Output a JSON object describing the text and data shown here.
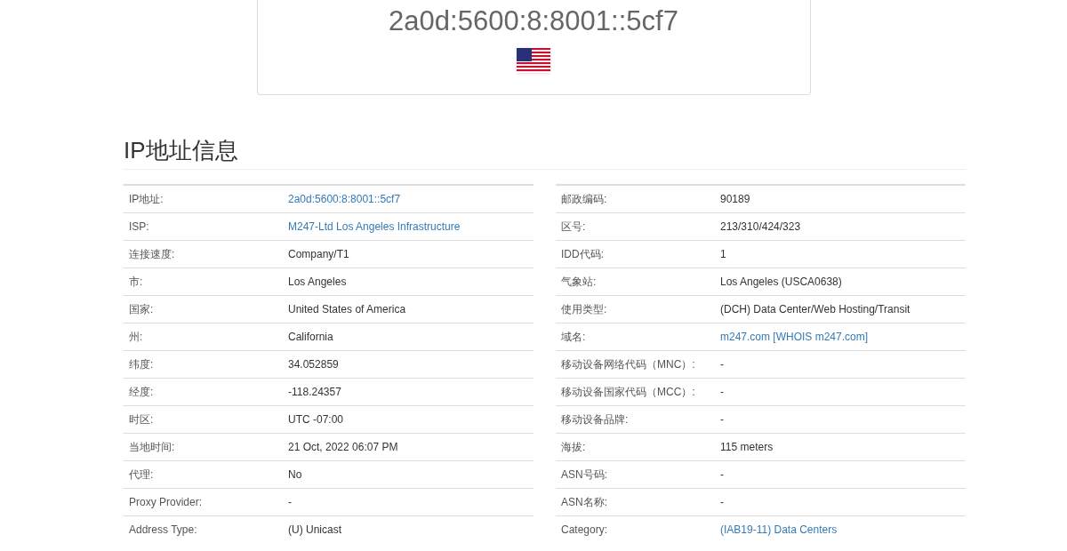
{
  "header": {
    "ip": "2a0d:5600:8:8001::5cf7"
  },
  "section": {
    "title": "IP地址信息"
  },
  "left_table": [
    {
      "label": "IP地址:",
      "value": "2a0d:5600:8:8001::5cf7",
      "link": true
    },
    {
      "label": "ISP:",
      "value": "M247-Ltd Los Angeles Infrastructure",
      "link": true
    },
    {
      "label": "连接速度:",
      "value": "Company/T1",
      "link": false
    },
    {
      "label": "市:",
      "value": "Los Angeles",
      "link": false
    },
    {
      "label": "国家:",
      "value": "United States of America",
      "link": false
    },
    {
      "label": "州:",
      "value": "California",
      "link": false
    },
    {
      "label": "纬度:",
      "value": "34.052859",
      "link": false
    },
    {
      "label": "经度:",
      "value": "-118.24357",
      "link": false
    },
    {
      "label": "时区:",
      "value": "UTC -07:00",
      "link": false
    },
    {
      "label": "当地时间:",
      "value": "21 Oct, 2022 06:07 PM",
      "link": false
    },
    {
      "label": "代理:",
      "value": "No",
      "link": false
    },
    {
      "label": "Proxy Provider:",
      "value": "-",
      "link": false
    },
    {
      "label": "Address Type:",
      "value": "(U) Unicast",
      "link": false
    }
  ],
  "right_table": [
    {
      "label": "邮政编码:",
      "value": "90189",
      "link": false
    },
    {
      "label": "区号:",
      "value": "213/310/424/323",
      "link": false
    },
    {
      "label": "IDD代码:",
      "value": "1",
      "link": false
    },
    {
      "label": "气象站:",
      "value": "Los Angeles (USCA0638)",
      "link": false
    },
    {
      "label": "使用类型:",
      "value": "(DCH) Data Center/Web Hosting/Transit",
      "link": false
    },
    {
      "label": "域名:",
      "value": "m247.com [WHOIS m247.com]",
      "link": true
    },
    {
      "label": "移动设备网络代码（MNC）:",
      "value": "-",
      "link": false
    },
    {
      "label": "移动设备国家代码（MCC）:",
      "value": "-",
      "link": false
    },
    {
      "label": "移动设备品牌:",
      "value": "-",
      "link": false
    },
    {
      "label": "海拔:",
      "value": "115 meters",
      "link": false
    },
    {
      "label": "ASN号码:",
      "value": "-",
      "link": false
    },
    {
      "label": "ASN名称:",
      "value": "-",
      "link": false
    },
    {
      "label": "Category:",
      "value": "(IAB19-11) Data Centers",
      "link": true
    }
  ]
}
